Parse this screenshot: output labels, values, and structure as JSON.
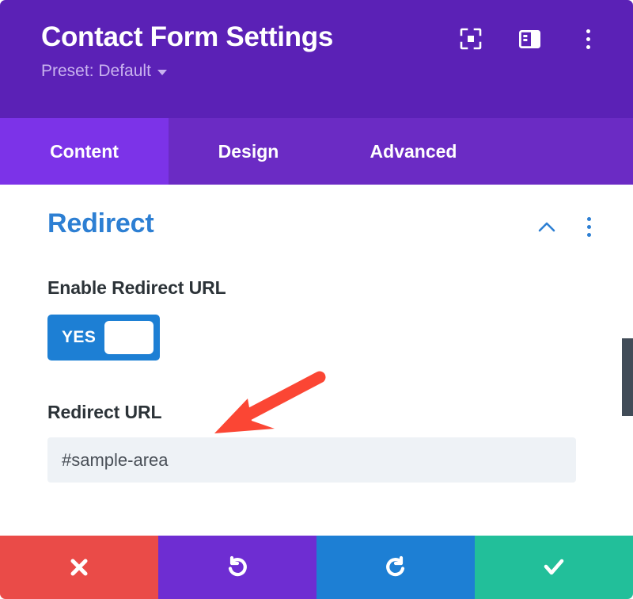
{
  "window": {
    "title": "Contact Form Settings",
    "preset_label": "Preset: Default",
    "header_bg": "#5b21b6"
  },
  "header_icons": [
    {
      "name": "focus-target-icon",
      "label": "Focus"
    },
    {
      "name": "layout-panel-icon",
      "label": "Layout"
    },
    {
      "name": "more-options-icon",
      "label": "More Options"
    }
  ],
  "tabs": [
    {
      "label": "Content",
      "active": true
    },
    {
      "label": "Design",
      "active": false
    },
    {
      "label": "Advanced",
      "active": false
    }
  ],
  "section": {
    "title": "Redirect",
    "title_color": "#2d7fd3",
    "collapse_icon": "chevron-up-icon",
    "menu_icon": "more-options-icon"
  },
  "fields": {
    "enable_redirect": {
      "label": "Enable Redirect URL",
      "toggle_value": "YES",
      "toggle_on": true,
      "toggle_color": "#1d7fd4"
    },
    "redirect_url": {
      "label": "Redirect URL",
      "value": "#sample-area",
      "placeholder": "#sample-area"
    }
  },
  "annotation": {
    "type": "arrow",
    "color": "#fb4634",
    "points_to": "redirect-url-label"
  },
  "action_bar": [
    {
      "name": "cancel-button",
      "icon": "close-icon",
      "color": "#ea4b48"
    },
    {
      "name": "undo-button",
      "icon": "undo-icon",
      "color": "#6e2dd2"
    },
    {
      "name": "redo-button",
      "icon": "redo-icon",
      "color": "#1d7fd4"
    },
    {
      "name": "save-button",
      "icon": "check-icon",
      "color": "#22bf9a"
    }
  ],
  "scrollbar": {
    "color": "#414c58"
  }
}
